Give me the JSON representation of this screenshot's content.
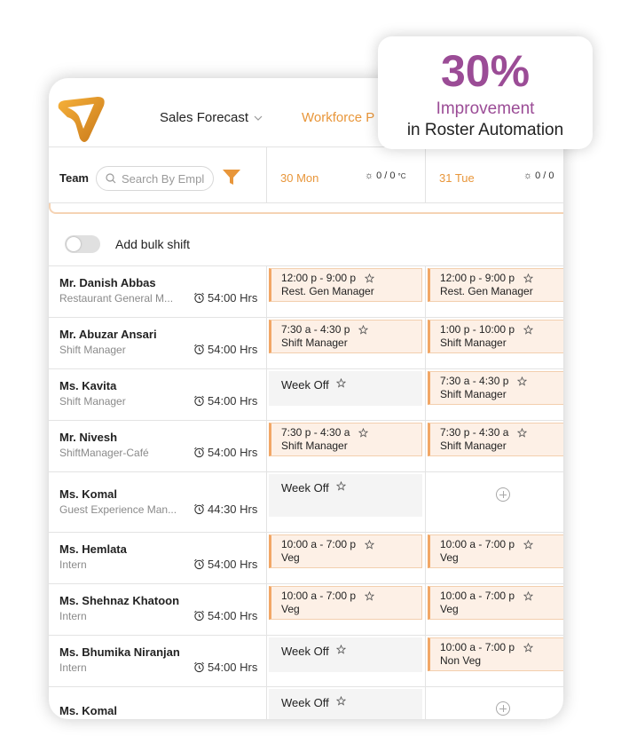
{
  "nav": {
    "sales_forecast": "Sales Forecast",
    "workforce": "Workforce P"
  },
  "filter": {
    "team_label": "Team",
    "search_placeholder": "Search By Empl"
  },
  "days": [
    {
      "label": "30 Mon",
      "weather": "0 / 0",
      "unit": "°C"
    },
    {
      "label": "31 Tue",
      "weather": "0 / 0",
      "unit": ""
    }
  ],
  "bulk_shift": {
    "label": "Add bulk shift",
    "enabled": false
  },
  "employees": [
    {
      "name": "Mr. Danish Abbas",
      "role": "Restaurant General M...",
      "hours": "54:00 Hrs",
      "shifts": [
        {
          "type": "shift",
          "time": "12:00 p - 9:00 p",
          "role": "Rest. Gen Manager"
        },
        {
          "type": "shift",
          "time": "12:00 p - 9:00 p",
          "role": "Rest. Gen Manager"
        }
      ]
    },
    {
      "name": "Mr. Abuzar Ansari",
      "role": "Shift Manager",
      "hours": "54:00 Hrs",
      "shifts": [
        {
          "type": "shift",
          "time": "7:30 a - 4:30 p",
          "role": "Shift Manager"
        },
        {
          "type": "shift",
          "time": "1:00 p - 10:00 p",
          "role": "Shift Manager"
        }
      ]
    },
    {
      "name": "Ms. Kavita",
      "role": "Shift Manager",
      "hours": "54:00 Hrs",
      "shifts": [
        {
          "type": "weekoff",
          "label": "Week Off"
        },
        {
          "type": "shift",
          "time": "7:30 a - 4:30 p",
          "role": "Shift Manager"
        }
      ]
    },
    {
      "name": "Mr. Nivesh",
      "role": "ShiftManager-Café",
      "hours": "54:00 Hrs",
      "shifts": [
        {
          "type": "shift",
          "time": "7:30 p - 4:30 a",
          "role": "Shift Manager"
        },
        {
          "type": "shift",
          "time": "7:30 p - 4:30 a",
          "role": "Shift Manager"
        }
      ]
    },
    {
      "name": "Ms. Komal",
      "role": "Guest Experience Man...",
      "hours": "44:30 Hrs",
      "shifts": [
        {
          "type": "weekoff",
          "label": "Week Off"
        },
        {
          "type": "add"
        }
      ]
    },
    {
      "name": "Ms. Hemlata",
      "role": "Intern",
      "hours": "54:00 Hrs",
      "shifts": [
        {
          "type": "shift",
          "time": "10:00 a - 7:00 p",
          "role": "Veg"
        },
        {
          "type": "shift",
          "time": "10:00 a - 7:00 p",
          "role": "Veg"
        }
      ]
    },
    {
      "name": "Ms. Shehnaz Khatoon",
      "role": "Intern",
      "hours": "54:00 Hrs",
      "shifts": [
        {
          "type": "shift",
          "time": "10:00 a - 7:00 p",
          "role": "Veg"
        },
        {
          "type": "shift",
          "time": "10:00 a - 7:00 p",
          "role": "Veg"
        }
      ]
    },
    {
      "name": "Ms. Bhumika Niranjan",
      "role": "Intern",
      "hours": "54:00 Hrs",
      "shifts": [
        {
          "type": "weekoff",
          "label": "Week Off"
        },
        {
          "type": "shift",
          "time": "10:00 a - 7:00 p",
          "role": "Non Veg"
        }
      ]
    },
    {
      "name": "Ms. Komal",
      "role": "",
      "hours": "",
      "shifts": [
        {
          "type": "weekoff",
          "label": "Week Off"
        },
        {
          "type": "add"
        }
      ]
    }
  ],
  "badge": {
    "percent": "30%",
    "improvement": "Improvement",
    "subtitle": "in Roster Automation"
  },
  "colors": {
    "accent_orange": "#e8963a",
    "badge_purple": "#9b4c96",
    "shift_bg": "#fdf0e6"
  }
}
